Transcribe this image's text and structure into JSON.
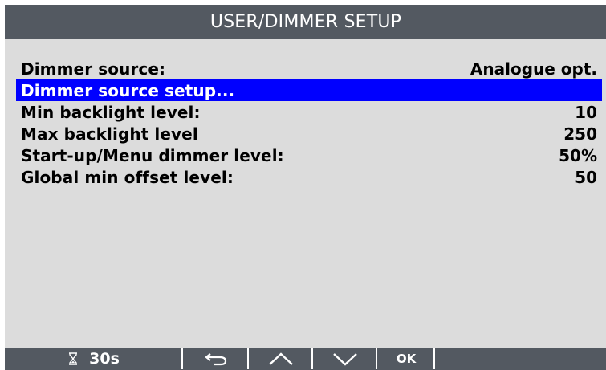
{
  "title": "USER/DIMMER SETUP",
  "menu": {
    "items": [
      {
        "label": "Dimmer source:",
        "value": "Analogue opt.",
        "selected": false
      },
      {
        "label": "Dimmer source setup...",
        "value": "",
        "selected": true
      },
      {
        "label": "Min backlight level:",
        "value": "10",
        "selected": false
      },
      {
        "label": "Max backlight level",
        "value": "250",
        "selected": false
      },
      {
        "label": "Start-up/Menu dimmer level:",
        "value": "50%",
        "selected": false
      },
      {
        "label": "Global min offset level:",
        "value": "50",
        "selected": false
      }
    ]
  },
  "softkeys": {
    "timer_icon": "hourglass-icon",
    "timer_label": "30s",
    "back_icon": "return-arrow-icon",
    "up_icon": "chevron-up-icon",
    "down_icon": "chevron-down-icon",
    "ok_label": "OK"
  },
  "colors": {
    "title_bar": "#535961",
    "background": "#dcdcdc",
    "selection": "#0000ff",
    "text": "#000000",
    "softkey_text": "#ffffff"
  }
}
